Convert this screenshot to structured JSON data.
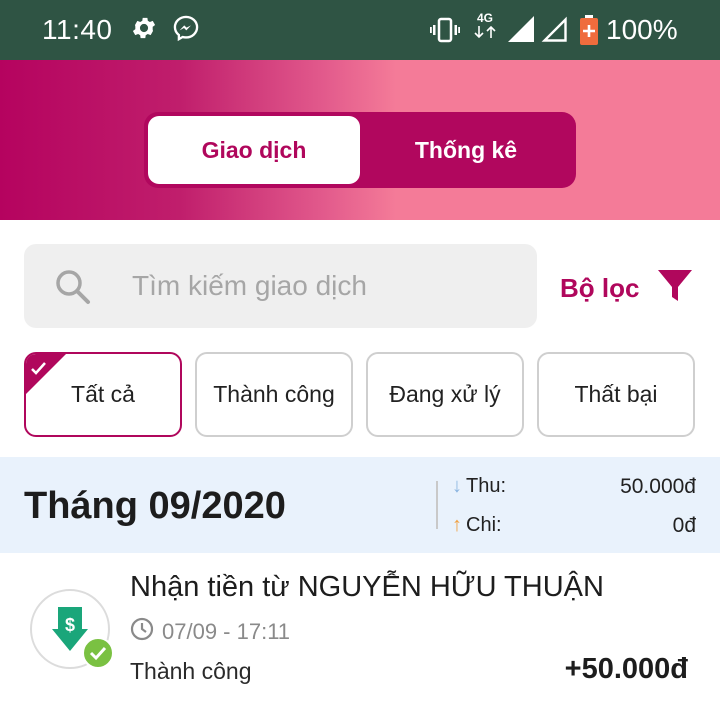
{
  "status_bar": {
    "time": "11:40",
    "network": "4G",
    "battery": "100%",
    "icons": [
      "gear-icon",
      "messenger-icon",
      "vibrate-icon",
      "signal-icon",
      "signal-empty-icon",
      "battery-icon"
    ]
  },
  "tabs": [
    {
      "label": "Giao dịch",
      "active": true
    },
    {
      "label": "Thống kê",
      "active": false
    }
  ],
  "search": {
    "placeholder": "Tìm kiếm giao dịch"
  },
  "filter": {
    "label": "Bộ lọc"
  },
  "chips": [
    {
      "label": "Tất cả",
      "selected": true
    },
    {
      "label": "Thành công",
      "selected": false
    },
    {
      "label": "Đang xử lý",
      "selected": false
    },
    {
      "label": "Thất bại",
      "selected": false
    }
  ],
  "summary": {
    "month": "Tháng 09/2020",
    "income_label": "Thu:",
    "income_value": "50.000đ",
    "expense_label": "Chi:",
    "expense_value": "0đ"
  },
  "transactions": [
    {
      "title": "Nhận tiền từ NGUYỄN HỮU THUẬN",
      "datetime": "07/09 - 17:11",
      "status": "Thành công",
      "amount": "+50.000đ"
    }
  ],
  "colors": {
    "brand": "#b0075c",
    "status_bar": "#2f5444",
    "money_in": "#1aa67a",
    "success": "#7ac142",
    "income_arrow": "#8ab4e0",
    "expense_arrow": "#f0a040"
  }
}
